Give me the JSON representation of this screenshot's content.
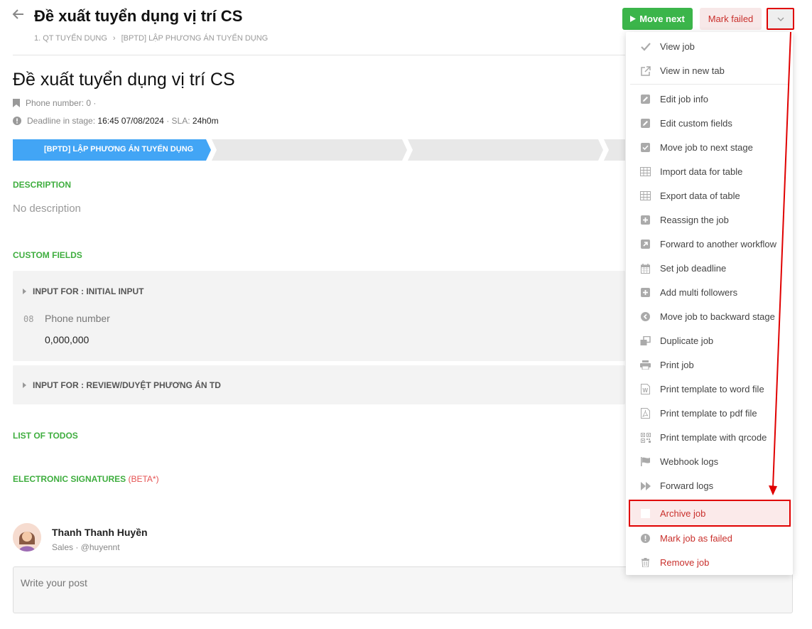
{
  "header": {
    "title": "Đề xuất tuyển dụng vị trí CS",
    "breadcrumb": [
      "1. QT TUYỂN DỤNG",
      "[BPTD] LẬP PHƯƠNG ÁN TUYỂN DỤNG"
    ],
    "move_next_label": "Move next",
    "mark_failed_label": "Mark failed"
  },
  "job": {
    "title": "Đề xuất tuyển dụng vị trí CS",
    "phone_label": "Phone number: 0 ·",
    "deadline_label": "Deadline in stage:",
    "deadline_value": "16:45 07/08/2024",
    "sla_label": "· SLA:",
    "sla_value": "24h0m",
    "stage_current": "[BPTD] LẬP PHƯƠNG ÁN TUYỂN DỤNG"
  },
  "sections": {
    "description": "DESCRIPTION",
    "no_description": "No description",
    "custom_fields": "CUSTOM FIELDS",
    "list_of_todos": "LIST OF TODOS",
    "e_signatures": "ELECTRONIC SIGNATURES",
    "beta": "(BETA*)"
  },
  "custom_fields": {
    "group1_title": "INPUT FOR : INITIAL INPUT",
    "field_icon_text": "08",
    "field_label": "Phone number",
    "field_value": "0,000,000",
    "group2_title": "INPUT FOR : REVIEW/DUYỆT PHƯƠNG ÁN TD"
  },
  "user": {
    "name": "Thanh Thanh Huyền",
    "subtitle": "Sales · @huyennt"
  },
  "post": {
    "placeholder": "Write your post"
  },
  "menu": {
    "items": [
      {
        "label": "View job",
        "icon": "check-icon"
      },
      {
        "label": "View in new tab",
        "icon": "external-link-icon"
      },
      {
        "label": "Edit job info",
        "icon": "edit-icon"
      },
      {
        "label": "Edit custom fields",
        "icon": "edit-icon"
      },
      {
        "label": "Move job to next stage",
        "icon": "check-square-icon"
      },
      {
        "label": "Import data for table",
        "icon": "table-icon"
      },
      {
        "label": "Export data of table",
        "icon": "table-icon"
      },
      {
        "label": "Reassign the job",
        "icon": "plus-square-icon"
      },
      {
        "label": "Forward to another workflow",
        "icon": "forward-square-icon"
      },
      {
        "label": "Set job deadline",
        "icon": "calendar-icon"
      },
      {
        "label": "Add multi followers",
        "icon": "plus-square-icon"
      },
      {
        "label": "Move job to backward stage",
        "icon": "back-circle-icon"
      },
      {
        "label": "Duplicate job",
        "icon": "duplicate-icon"
      },
      {
        "label": "Print job",
        "icon": "printer-icon"
      },
      {
        "label": "Print template to word file",
        "icon": "word-file-icon"
      },
      {
        "label": "Print template to pdf file",
        "icon": "pdf-file-icon"
      },
      {
        "label": "Print template with qrcode",
        "icon": "qrcode-icon"
      },
      {
        "label": "Webhook logs",
        "icon": "flag-icon"
      },
      {
        "label": "Forward logs",
        "icon": "fast-forward-icon"
      },
      {
        "label": "Archive job",
        "icon": "archive-icon"
      },
      {
        "label": "Mark job as failed",
        "icon": "exclamation-circle-icon"
      },
      {
        "label": "Remove job",
        "icon": "trash-icon"
      }
    ]
  },
  "colors": {
    "green": "#3bb54a",
    "danger": "#c9302c",
    "stage_blue": "#42a5f5",
    "annotation_red": "#e00000"
  }
}
